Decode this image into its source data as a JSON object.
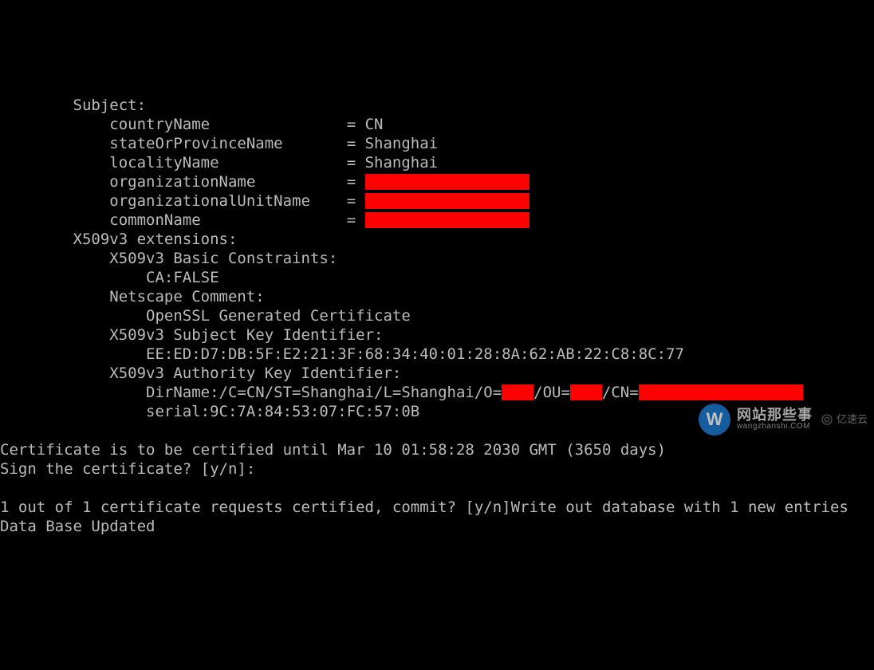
{
  "cert": {
    "subject_header": "Subject:",
    "subject": {
      "countryName": {
        "label": "countryName",
        "value": "CN",
        "redacted": false
      },
      "stateOrProvinceName": {
        "label": "stateOrProvinceName",
        "value": "Shanghai",
        "redacted": false
      },
      "localityName": {
        "label": "localityName",
        "value": "Shanghai",
        "redacted": false
      },
      "organizationName": {
        "label": "organizationName",
        "value": "",
        "redacted": true
      },
      "organizationalUnitName": {
        "label": "organizationalUnitName",
        "value": "",
        "redacted": true
      },
      "commonName": {
        "label": "commonName",
        "value": "",
        "redacted": true
      }
    },
    "ext_header": "X509v3 extensions:",
    "basic_constraints_label": "X509v3 Basic Constraints:",
    "basic_constraints_value": "CA:FALSE",
    "netscape_label": "Netscape Comment:",
    "netscape_value": "OpenSSL Generated Certificate",
    "ski_label": "X509v3 Subject Key Identifier:",
    "ski_value": "EE:ED:D7:DB:5F:E2:21:3F:68:34:40:01:28:8A:62:AB:22:C8:8C:77",
    "aki_label": "X509v3 Authority Key Identifier:",
    "aki_dirname_prefix": "DirName:/C=CN/ST=Shanghai/L=Shanghai/O=",
    "aki_ou": "/OU=",
    "aki_cn": "/CN=",
    "aki_serial": "serial:9C:7A:84:53:07:FC:57:0B",
    "until_line": "Certificate is to be certified until Mar 10 01:58:28 2030 GMT (3650 days)",
    "sign_prompt": "Sign the certificate? [y/n]:",
    "commit_line": "1 out of 1 certificate requests certified, commit? [y/n]Write out database with 1 new entries",
    "updated_line": "Data Base Updated"
  },
  "watermarks": {
    "logo_letter": "W",
    "brand_cn": "网站那些事",
    "brand_en": "wangzhanshi.COM",
    "yisu": "亿速云"
  },
  "colors": {
    "redaction": "#ff0000",
    "background": "#000000",
    "text": "#bbbbbb"
  }
}
